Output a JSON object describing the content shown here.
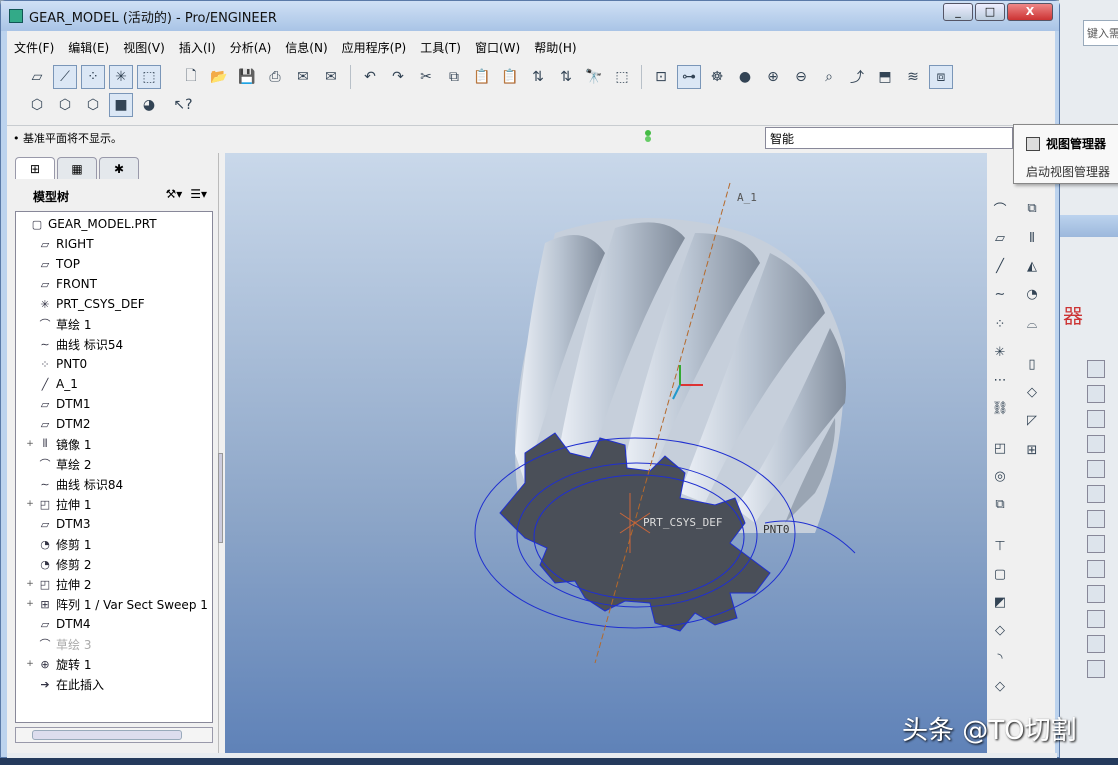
{
  "window": {
    "title": "GEAR_MODEL (活动的) - Pro/ENGINEER",
    "min": "_",
    "max": "□",
    "close": "X"
  },
  "menu": [
    "文件(F)",
    "编辑(E)",
    "视图(V)",
    "插入(I)",
    "分析(A)",
    "信息(N)",
    "应用程序(P)",
    "工具(T)",
    "窗口(W)",
    "帮助(H)"
  ],
  "message": "• 基准平面将不显示。",
  "filter": {
    "value": "智能"
  },
  "tooltip": {
    "title": "视图管理器",
    "desc": "启动视图管理器"
  },
  "search": {
    "placeholder": "键入需"
  },
  "modeltree": {
    "label": "模型树",
    "items": [
      {
        "exp": "",
        "icon": "part-icon",
        "glyph": "▢",
        "label": "GEAR_MODEL.PRT",
        "dim": false
      },
      {
        "exp": "",
        "icon": "datum-plane-icon",
        "glyph": "▱",
        "label": "RIGHT",
        "dim": false
      },
      {
        "exp": "",
        "icon": "datum-plane-icon",
        "glyph": "▱",
        "label": "TOP",
        "dim": false
      },
      {
        "exp": "",
        "icon": "datum-plane-icon",
        "glyph": "▱",
        "label": "FRONT",
        "dim": false
      },
      {
        "exp": "",
        "icon": "csys-icon",
        "glyph": "✳",
        "label": "PRT_CSYS_DEF",
        "dim": false
      },
      {
        "exp": "",
        "icon": "sketch-icon",
        "glyph": "⌒",
        "label": "草绘 1",
        "dim": false
      },
      {
        "exp": "",
        "icon": "curve-icon",
        "glyph": "∼",
        "label": "曲线 标识54",
        "dim": false
      },
      {
        "exp": "",
        "icon": "point-icon",
        "glyph": "⁘",
        "label": "PNT0",
        "dim": false
      },
      {
        "exp": "",
        "icon": "axis-icon",
        "glyph": "╱",
        "label": "A_1",
        "dim": false
      },
      {
        "exp": "",
        "icon": "datum-plane-icon",
        "glyph": "▱",
        "label": "DTM1",
        "dim": false
      },
      {
        "exp": "",
        "icon": "datum-plane-icon",
        "glyph": "▱",
        "label": "DTM2",
        "dim": false
      },
      {
        "exp": "+",
        "icon": "mirror-icon",
        "glyph": "⫴",
        "label": "镜像 1",
        "dim": false
      },
      {
        "exp": "",
        "icon": "sketch-icon",
        "glyph": "⌒",
        "label": "草绘 2",
        "dim": false
      },
      {
        "exp": "",
        "icon": "curve-icon",
        "glyph": "∼",
        "label": "曲线 标识84",
        "dim": false
      },
      {
        "exp": "+",
        "icon": "extrude-icon",
        "glyph": "◰",
        "label": "拉伸 1",
        "dim": false
      },
      {
        "exp": "",
        "icon": "datum-plane-icon",
        "glyph": "▱",
        "label": "DTM3",
        "dim": false
      },
      {
        "exp": "",
        "icon": "trim-icon",
        "glyph": "◔",
        "label": "修剪 1",
        "dim": false
      },
      {
        "exp": "",
        "icon": "trim-icon",
        "glyph": "◔",
        "label": "修剪 2",
        "dim": false
      },
      {
        "exp": "+",
        "icon": "extrude-icon",
        "glyph": "◰",
        "label": "拉伸 2",
        "dim": false
      },
      {
        "exp": "+",
        "icon": "pattern-icon",
        "glyph": "⊞",
        "label": "阵列 1 / Var Sect Sweep 1",
        "dim": false
      },
      {
        "exp": "",
        "icon": "datum-plane-icon",
        "glyph": "▱",
        "label": "DTM4",
        "dim": false
      },
      {
        "exp": "",
        "icon": "sketch-icon",
        "glyph": "⌒",
        "label": "草绘 3",
        "dim": true
      },
      {
        "exp": "+",
        "icon": "revolve-icon",
        "glyph": "⊕",
        "label": "旋转 1",
        "dim": false
      },
      {
        "exp": "",
        "icon": "insert-here-icon",
        "glyph": "➔",
        "label": "在此插入",
        "dim": false
      }
    ]
  },
  "viewport": {
    "axis_label": "A_1",
    "csys_label": "PRT_CSYS_DEF",
    "point_label": "PNT0",
    "colors": {
      "gear": "#c8d2df",
      "face": "#4a4f58",
      "curve": "#1f2fd0",
      "axis": "#b5692a"
    }
  },
  "watermark": "头条 @TO切割"
}
